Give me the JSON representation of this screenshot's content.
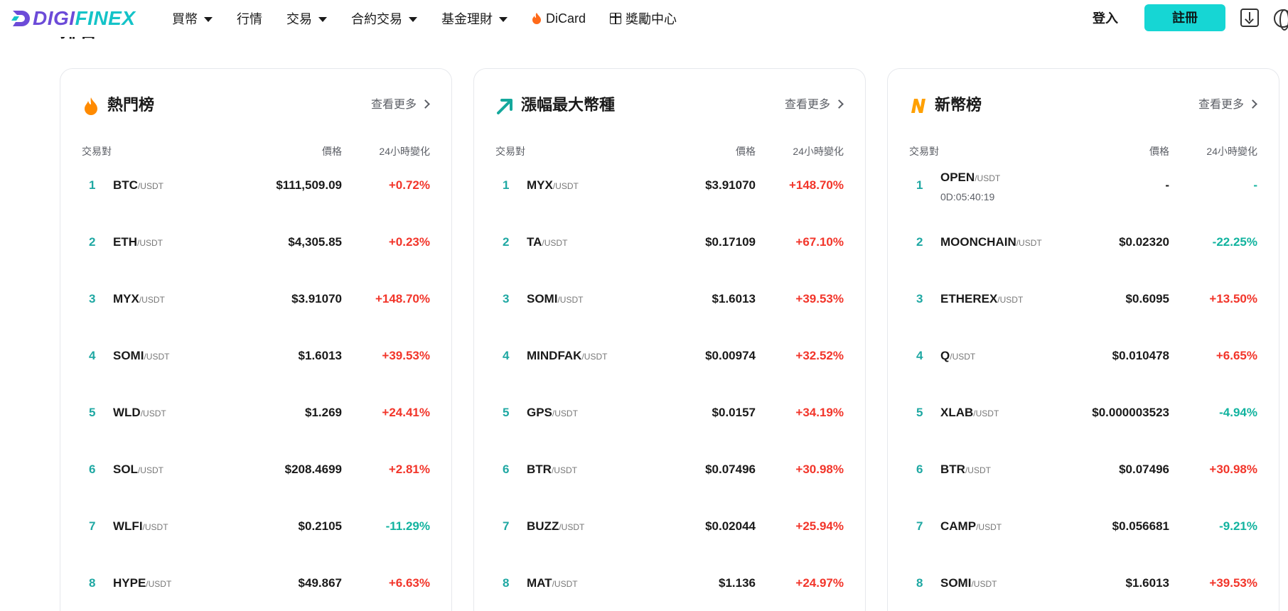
{
  "header": {
    "logo": {
      "part1": "DIGI",
      "part2": "FINEX"
    },
    "nav": [
      {
        "label": "買幣",
        "caret": true
      },
      {
        "label": "行情",
        "caret": false
      },
      {
        "label": "交易",
        "caret": true
      },
      {
        "label": "合約交易",
        "caret": true
      },
      {
        "label": "基金理財",
        "caret": true
      },
      {
        "label": "DiCard",
        "icon": "fire-icon"
      },
      {
        "label": "獎勵中心",
        "icon": "gift-icon"
      }
    ],
    "login": "登入",
    "register": "註冊"
  },
  "section_title": "排名",
  "colors": {
    "accent": "#16d6d4",
    "up": "#f2352a",
    "down": "#12b39f",
    "rank": "#1fa8a3"
  },
  "cards": [
    {
      "title": "熱門榜",
      "icon": "flame-icon",
      "more": "查看更多",
      "headers": {
        "pair": "交易對",
        "price": "價格",
        "change": "24小時變化"
      },
      "rows": [
        {
          "rank": "1",
          "base": "BTC",
          "quote": "/USDT",
          "price": "$111,509.09",
          "change": "+0.72%",
          "dir": "up"
        },
        {
          "rank": "2",
          "base": "ETH",
          "quote": "/USDT",
          "price": "$4,305.85",
          "change": "+0.23%",
          "dir": "up"
        },
        {
          "rank": "3",
          "base": "MYX",
          "quote": "/USDT",
          "price": "$3.91070",
          "change": "+148.70%",
          "dir": "up"
        },
        {
          "rank": "4",
          "base": "SOMI",
          "quote": "/USDT",
          "price": "$1.6013",
          "change": "+39.53%",
          "dir": "up"
        },
        {
          "rank": "5",
          "base": "WLD",
          "quote": "/USDT",
          "price": "$1.269",
          "change": "+24.41%",
          "dir": "up"
        },
        {
          "rank": "6",
          "base": "SOL",
          "quote": "/USDT",
          "price": "$208.4699",
          "change": "+2.81%",
          "dir": "up"
        },
        {
          "rank": "7",
          "base": "WLFI",
          "quote": "/USDT",
          "price": "$0.2105",
          "change": "-11.29%",
          "dir": "down"
        },
        {
          "rank": "8",
          "base": "HYPE",
          "quote": "/USDT",
          "price": "$49.867",
          "change": "+6.63%",
          "dir": "up"
        }
      ]
    },
    {
      "title": "漲幅最大幣種",
      "icon": "trend-up-arrow-icon",
      "more": "查看更多",
      "headers": {
        "pair": "交易對",
        "price": "價格",
        "change": "24小時變化"
      },
      "rows": [
        {
          "rank": "1",
          "base": "MYX",
          "quote": "/USDT",
          "price": "$3.91070",
          "change": "+148.70%",
          "dir": "up"
        },
        {
          "rank": "2",
          "base": "TA",
          "quote": "/USDT",
          "price": "$0.17109",
          "change": "+67.10%",
          "dir": "up"
        },
        {
          "rank": "3",
          "base": "SOMI",
          "quote": "/USDT",
          "price": "$1.6013",
          "change": "+39.53%",
          "dir": "up"
        },
        {
          "rank": "4",
          "base": "MINDFAK",
          "quote": "/USDT",
          "price": "$0.00974",
          "change": "+32.52%",
          "dir": "up"
        },
        {
          "rank": "5",
          "base": "GPS",
          "quote": "/USDT",
          "price": "$0.0157",
          "change": "+34.19%",
          "dir": "up"
        },
        {
          "rank": "6",
          "base": "BTR",
          "quote": "/USDT",
          "price": "$0.07496",
          "change": "+30.98%",
          "dir": "up"
        },
        {
          "rank": "7",
          "base": "BUZZ",
          "quote": "/USDT",
          "price": "$0.02044",
          "change": "+25.94%",
          "dir": "up"
        },
        {
          "rank": "8",
          "base": "MAT",
          "quote": "/USDT",
          "price": "$1.136",
          "change": "+24.97%",
          "dir": "up"
        }
      ]
    },
    {
      "title": "新幣榜",
      "icon": "new-n-icon",
      "more": "查看更多",
      "headers": {
        "pair": "交易對",
        "price": "價格",
        "change": "24小時變化"
      },
      "rows": [
        {
          "rank": "1",
          "base": "OPEN",
          "quote": "/USDT",
          "sub": "0D:05:40:19",
          "price": "-",
          "change": "-",
          "dir": "flat"
        },
        {
          "rank": "2",
          "base": "MOONCHAIN",
          "quote": "/USDT",
          "price": "$0.02320",
          "change": "-22.25%",
          "dir": "down"
        },
        {
          "rank": "3",
          "base": "ETHEREX",
          "quote": "/USDT",
          "price": "$0.6095",
          "change": "+13.50%",
          "dir": "up"
        },
        {
          "rank": "4",
          "base": "Q",
          "quote": "/USDT",
          "price": "$0.010478",
          "change": "+6.65%",
          "dir": "up"
        },
        {
          "rank": "5",
          "base": "XLAB",
          "quote": "/USDT",
          "price": "$0.000003523",
          "change": "-4.94%",
          "dir": "down"
        },
        {
          "rank": "6",
          "base": "BTR",
          "quote": "/USDT",
          "price": "$0.07496",
          "change": "+30.98%",
          "dir": "up"
        },
        {
          "rank": "7",
          "base": "CAMP",
          "quote": "/USDT",
          "price": "$0.056681",
          "change": "-9.21%",
          "dir": "down"
        },
        {
          "rank": "8",
          "base": "SOMI",
          "quote": "/USDT",
          "price": "$1.6013",
          "change": "+39.53%",
          "dir": "up"
        }
      ]
    }
  ]
}
